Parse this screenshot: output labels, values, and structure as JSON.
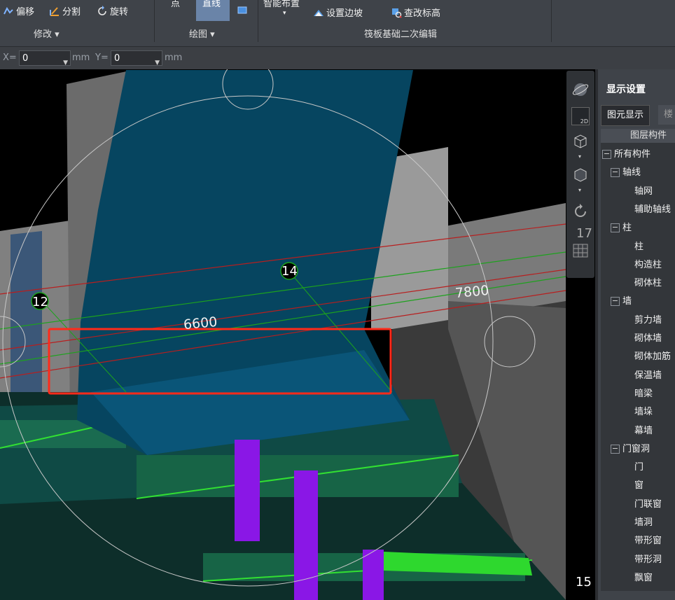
{
  "ribbon": {
    "offset_label": "偏移",
    "split_label": "分割",
    "rotate_label": "旋转",
    "modify_group": "修改 ▾",
    "point_label": "点",
    "line_label": "直线",
    "draw_group": "绘图 ▾",
    "smart_layout_label": "智能布置",
    "smart_layout_arrow": "▾",
    "set_slope_label": "设置边坡",
    "check_elevation_label": "查改标高",
    "raft_group": "筏板基础二次编辑"
  },
  "coords": {
    "x_label": "X=",
    "x_value": "0",
    "unit1": "mm",
    "y_label": "Y=",
    "y_value": "0",
    "unit2": "mm"
  },
  "viewport": {
    "axis_12": "12",
    "axis_14": "14",
    "axis_15": "15",
    "axis_17": "17",
    "dim_6600": "6600",
    "dim_7800": "7800"
  },
  "toolbar": {
    "view_2d": "2D"
  },
  "panel": {
    "title": "显示设置",
    "tab_elements": "图元显示",
    "tab_floor": "楼",
    "table_header": "图层构件",
    "tree": [
      {
        "label": "所有构件",
        "level": 0,
        "box": "−"
      },
      {
        "label": "轴线",
        "level": 1,
        "box": "−"
      },
      {
        "label": "轴网",
        "level": 2,
        "box": ""
      },
      {
        "label": "辅助轴线",
        "level": 2,
        "box": ""
      },
      {
        "label": "柱",
        "level": 1,
        "box": "−"
      },
      {
        "label": "柱",
        "level": 2,
        "box": ""
      },
      {
        "label": "构造柱",
        "level": 2,
        "box": ""
      },
      {
        "label": "砌体柱",
        "level": 2,
        "box": ""
      },
      {
        "label": "墙",
        "level": 1,
        "box": "−"
      },
      {
        "label": "剪力墙",
        "level": 2,
        "box": ""
      },
      {
        "label": "砌体墙",
        "level": 2,
        "box": ""
      },
      {
        "label": "砌体加筋",
        "level": 2,
        "box": ""
      },
      {
        "label": "保温墙",
        "level": 2,
        "box": ""
      },
      {
        "label": "暗梁",
        "level": 2,
        "box": ""
      },
      {
        "label": "墙垛",
        "level": 2,
        "box": ""
      },
      {
        "label": "幕墙",
        "level": 2,
        "box": ""
      },
      {
        "label": "门窗洞",
        "level": 1,
        "box": "−"
      },
      {
        "label": "门",
        "level": 2,
        "box": ""
      },
      {
        "label": "窗",
        "level": 2,
        "box": ""
      },
      {
        "label": "门联窗",
        "level": 2,
        "box": ""
      },
      {
        "label": "墙洞",
        "level": 2,
        "box": ""
      },
      {
        "label": "带形窗",
        "level": 2,
        "box": ""
      },
      {
        "label": "带形洞",
        "level": 2,
        "box": ""
      },
      {
        "label": "飘窗",
        "level": 2,
        "box": ""
      }
    ]
  },
  "colors": {
    "accent_blue": "#6a84a8",
    "highlight_red": "#ff2a1a",
    "slab_blue": "#064560",
    "column_purple": "#8a17e6",
    "mesh_green": "#32e032"
  }
}
